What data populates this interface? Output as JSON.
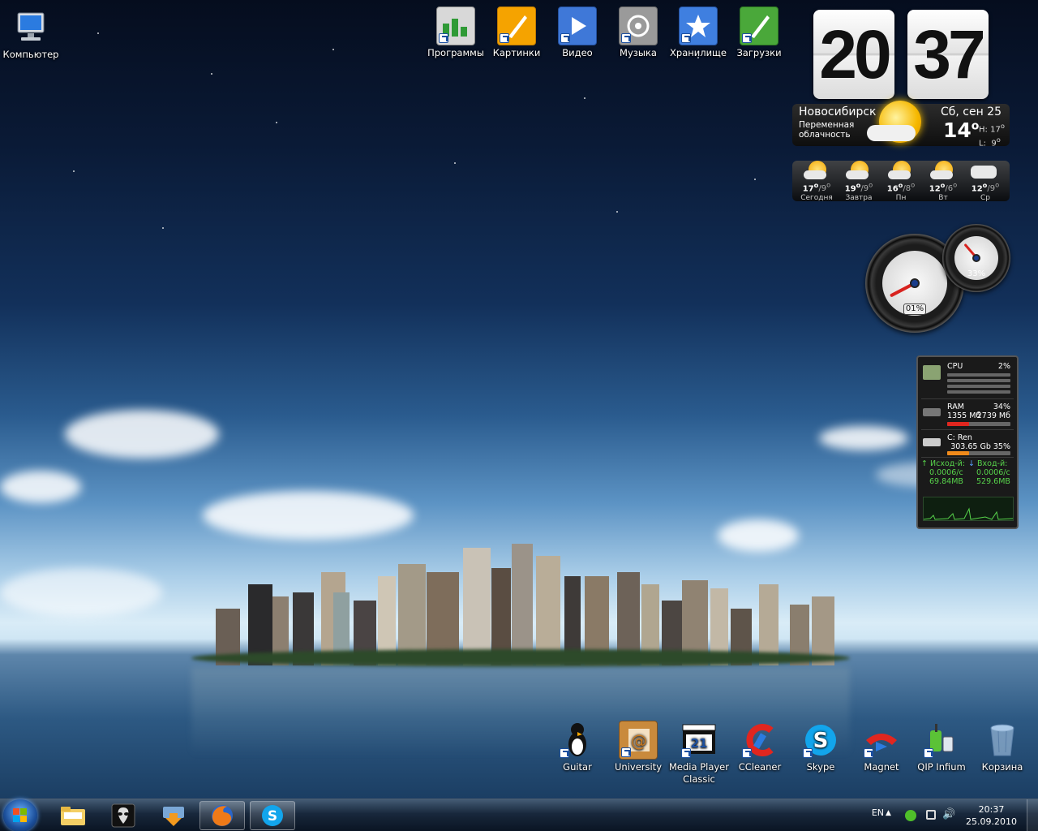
{
  "desktop": {
    "computer": {
      "label": "Компьютер"
    },
    "top_icons": [
      {
        "label": "Программы",
        "icon": "programs-icon",
        "color": "#8a8a8a"
      },
      {
        "label": "Картинки",
        "icon": "pictures-icon",
        "color": "#f5a300"
      },
      {
        "label": "Видео",
        "icon": "video-icon",
        "color": "#3f78d8"
      },
      {
        "label": "Музыка",
        "icon": "music-icon",
        "color": "#9a9a9a"
      },
      {
        "label": "Хранилище",
        "icon": "storage-icon",
        "color": "#3f7fe0"
      },
      {
        "label": "Загрузки",
        "icon": "downloads-icon",
        "color": "#4aa83a"
      }
    ],
    "bottom_icons": [
      {
        "label": "Guitar",
        "icon": "guitar-icon"
      },
      {
        "label": "University",
        "icon": "university-icon"
      },
      {
        "label": "Media Player Classic",
        "icon": "media-player-classic-icon"
      },
      {
        "label": "CCleaner",
        "icon": "ccleaner-icon"
      },
      {
        "label": "Skype",
        "icon": "skype-icon"
      },
      {
        "label": "Magnet",
        "icon": "magnet-icon"
      },
      {
        "label": "QIP Infium",
        "icon": "qip-infium-icon"
      },
      {
        "label": "Корзина",
        "icon": "recycle-bin-icon"
      }
    ]
  },
  "clock": {
    "hours": "20",
    "minutes": "37",
    "city": "Новосибирск",
    "condition": "Переменная облачность",
    "date": "Сб, сен 25",
    "temp": "14",
    "high_label": "H:",
    "high": "17",
    "low_label": "L:",
    "low": "9"
  },
  "forecast": [
    {
      "hi": "17",
      "lo": "9",
      "day": "Сегодня",
      "icon": "partly-cloudy-icon"
    },
    {
      "hi": "19",
      "lo": "9",
      "day": "Завтра",
      "icon": "partly-cloudy-icon"
    },
    {
      "hi": "16",
      "lo": "8",
      "day": "Пн",
      "icon": "partly-cloudy-icon"
    },
    {
      "hi": "12",
      "lo": "6",
      "day": "Вт",
      "icon": "partly-cloudy-icon"
    },
    {
      "hi": "12",
      "lo": "9",
      "day": "Ср",
      "icon": "cloudy-icon"
    }
  ],
  "gauges": {
    "cpu_readout": "01%",
    "cpu_level": 0.01,
    "memory_readout": "33%",
    "memory_level": 0.33
  },
  "sysmon": {
    "cpu": {
      "label": "CPU",
      "value": "2%"
    },
    "ram": {
      "label": "RAM",
      "value": "34%",
      "used": "1355 Мб",
      "total": "2739 Мб",
      "level": 0.34
    },
    "disk": {
      "label": "C: Ren",
      "value": "303.65 Gb 35%",
      "level": 0.35
    },
    "net": {
      "out_label": "Исход-й:",
      "out_rate": "0.0006/с",
      "out_total": "69.84MB",
      "in_label": "Вход-й:",
      "in_rate": "0.0006/с",
      "in_total": "529.6MB"
    },
    "colors": {
      "ram_fill": "#e0261f",
      "disk_fill": "#f08a1a",
      "net": "#57d34b"
    }
  },
  "taskbar": {
    "pinned": [
      {
        "name": "explorer",
        "icon": "folder-icon"
      },
      {
        "name": "alien",
        "icon": "alien-icon"
      },
      {
        "name": "downloader",
        "icon": "download-manager-icon"
      },
      {
        "name": "firefox",
        "icon": "firefox-icon"
      },
      {
        "name": "skype",
        "icon": "skype-icon"
      }
    ],
    "lang": "EN",
    "time": "20:37",
    "date": "25.09.2010"
  }
}
